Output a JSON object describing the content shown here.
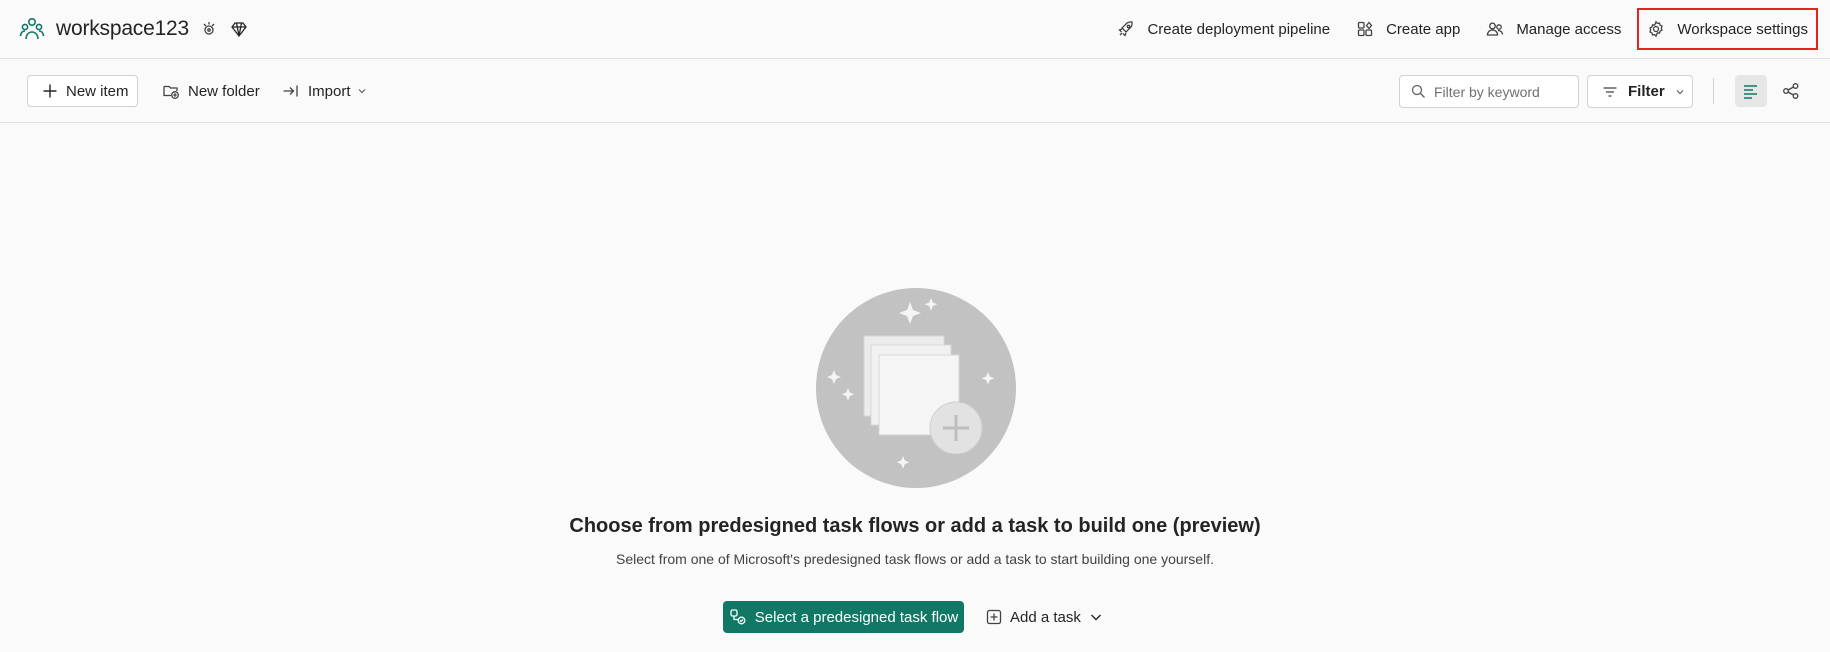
{
  "workspace": {
    "name": "workspace123",
    "logo_icon": "workspace-icon",
    "badges": [
      "identity-icon",
      "premium-diamond-icon"
    ],
    "accent_color": "#117865"
  },
  "header_actions": [
    {
      "label": "Create deployment pipeline",
      "icon": "rocket-icon"
    },
    {
      "label": "Create app",
      "icon": "app-icon"
    },
    {
      "label": "Manage access",
      "icon": "people-icon"
    },
    {
      "label": "Workspace settings",
      "icon": "gear-icon",
      "highlight_color": "#e02424"
    }
  ],
  "toolbar": {
    "new_item": "New item",
    "new_folder": "New folder",
    "import": "Import",
    "search_placeholder": "Filter by keyword",
    "filter": "Filter",
    "views": [
      "list-view-icon",
      "lineage-view-icon"
    ]
  },
  "empty_state": {
    "title": "Choose from predesigned task flows or add a task to build one (preview)",
    "subtitle": "Select from one of Microsoft's predesigned task flows or add a task to start building one yourself.",
    "primary_button": "Select a predesigned task flow",
    "secondary_button": "Add a task"
  }
}
